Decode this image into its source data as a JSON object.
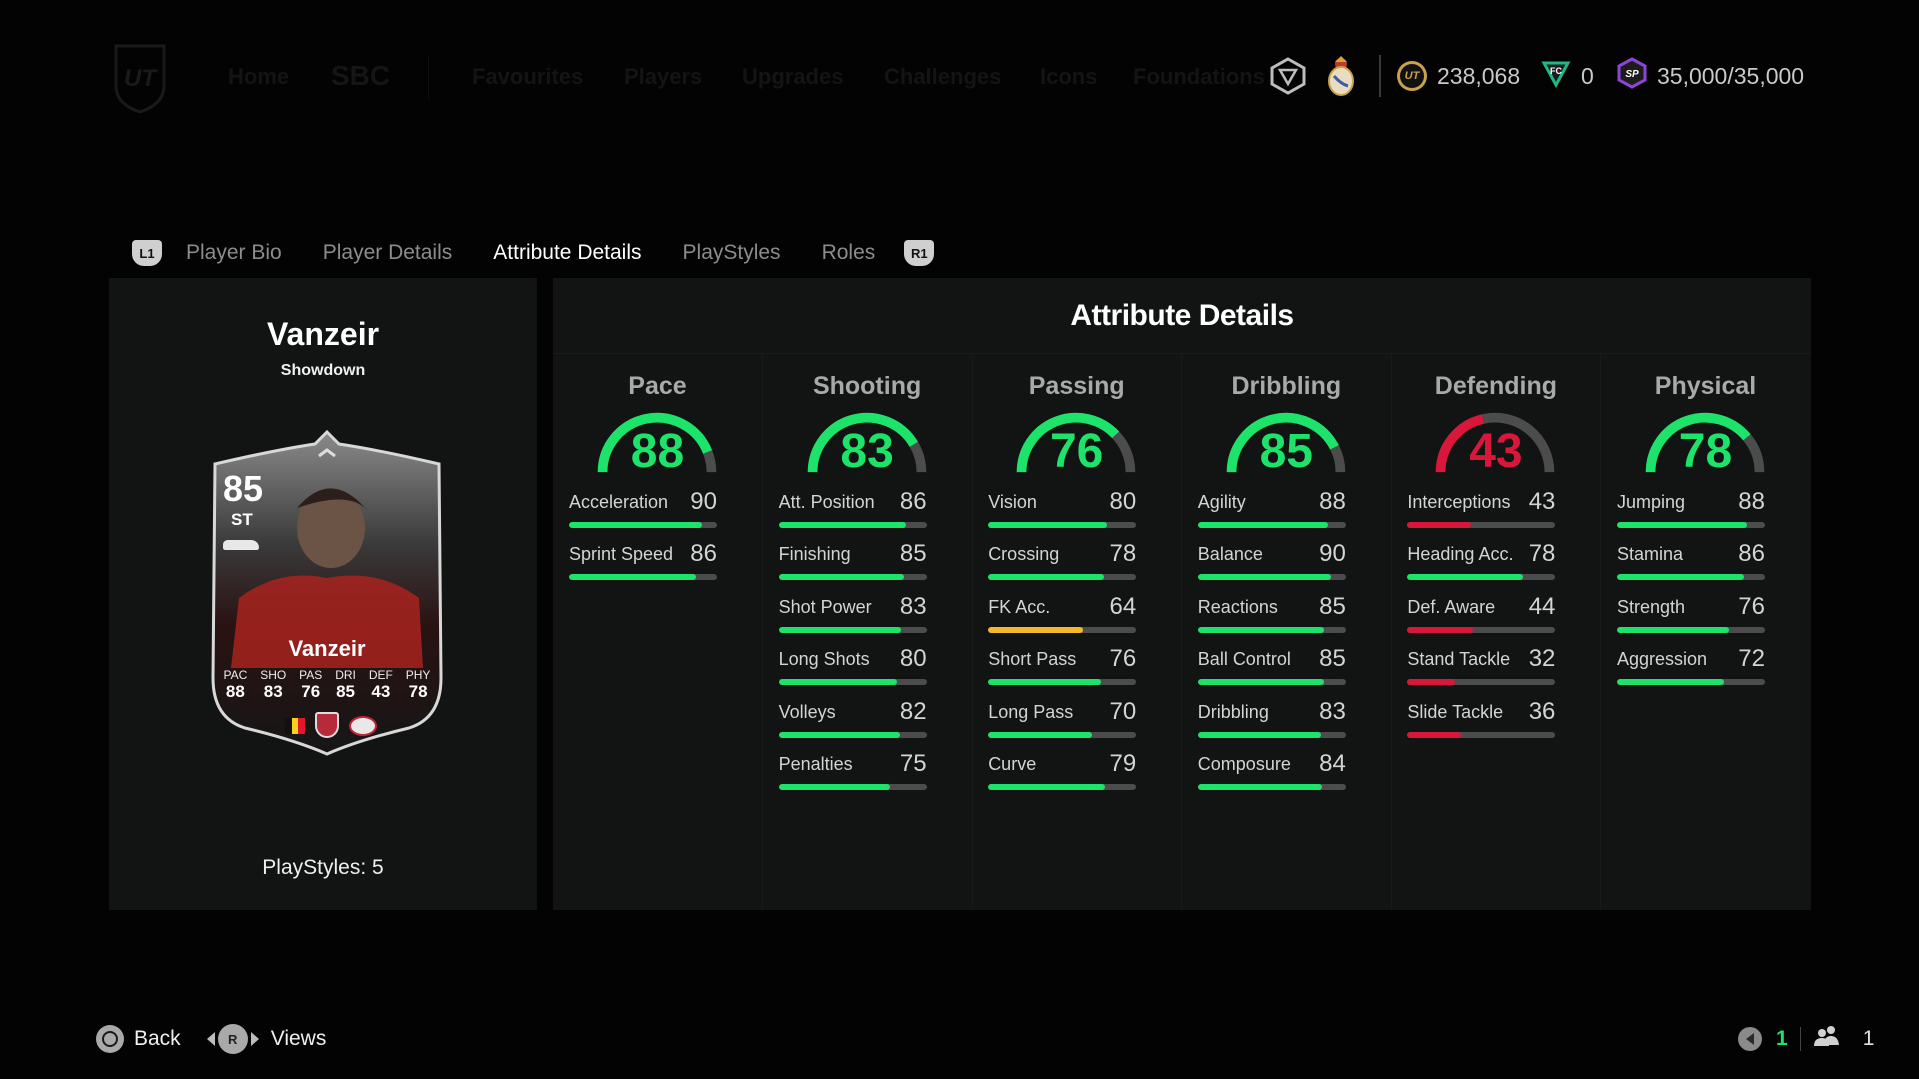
{
  "nav": {
    "items": [
      {
        "label": "Home"
      },
      {
        "label": "SBC"
      },
      {
        "label": "Favourites"
      },
      {
        "label": "Players"
      },
      {
        "label": "Upgrades"
      },
      {
        "label": "Challenges"
      },
      {
        "label": "Icons"
      },
      {
        "label": "Foundations"
      }
    ]
  },
  "currency": {
    "coins": "238,068",
    "fc_points": "0",
    "season_points": "35,000/35,000"
  },
  "tabs": {
    "left_button": "L1",
    "right_button": "R1",
    "items": [
      {
        "label": "Player Bio",
        "active": false
      },
      {
        "label": "Player Details",
        "active": false
      },
      {
        "label": "Attribute Details",
        "active": true
      },
      {
        "label": "PlayStyles",
        "active": false
      },
      {
        "label": "Roles",
        "active": false
      }
    ]
  },
  "player": {
    "name": "Vanzeir",
    "card_type": "Showdown",
    "playstyles": "PlayStyles: 5",
    "card": {
      "rating": "85",
      "position": "ST",
      "name": "Vanzeir",
      "stats": [
        {
          "label": "PAC",
          "value": "88"
        },
        {
          "label": "SHO",
          "value": "83"
        },
        {
          "label": "PAS",
          "value": "76"
        },
        {
          "label": "DRI",
          "value": "85"
        },
        {
          "label": "DEF",
          "value": "43"
        },
        {
          "label": "PHY",
          "value": "78"
        }
      ]
    }
  },
  "attributes": {
    "title": "Attribute Details",
    "colors": {
      "high": "#1ee36b",
      "mid": "#f5b82a",
      "low": "#d9173a",
      "track": "#4b4c4b"
    },
    "categories": [
      {
        "name": "Pace",
        "value": 88,
        "items": [
          {
            "label": "Acceleration",
            "value": 90
          },
          {
            "label": "Sprint Speed",
            "value": 86
          }
        ]
      },
      {
        "name": "Shooting",
        "value": 83,
        "items": [
          {
            "label": "Att. Position",
            "value": 86
          },
          {
            "label": "Finishing",
            "value": 85
          },
          {
            "label": "Shot Power",
            "value": 83
          },
          {
            "label": "Long Shots",
            "value": 80
          },
          {
            "label": "Volleys",
            "value": 82
          },
          {
            "label": "Penalties",
            "value": 75
          }
        ]
      },
      {
        "name": "Passing",
        "value": 76,
        "items": [
          {
            "label": "Vision",
            "value": 80
          },
          {
            "label": "Crossing",
            "value": 78
          },
          {
            "label": "FK Acc.",
            "value": 64
          },
          {
            "label": "Short Pass",
            "value": 76
          },
          {
            "label": "Long Pass",
            "value": 70
          },
          {
            "label": "Curve",
            "value": 79
          }
        ]
      },
      {
        "name": "Dribbling",
        "value": 85,
        "items": [
          {
            "label": "Agility",
            "value": 88
          },
          {
            "label": "Balance",
            "value": 90
          },
          {
            "label": "Reactions",
            "value": 85
          },
          {
            "label": "Ball Control",
            "value": 85
          },
          {
            "label": "Dribbling",
            "value": 83
          },
          {
            "label": "Composure",
            "value": 84
          }
        ]
      },
      {
        "name": "Defending",
        "value": 43,
        "items": [
          {
            "label": "Interceptions",
            "value": 43
          },
          {
            "label": "Heading Acc.",
            "value": 78
          },
          {
            "label": "Def. Aware",
            "value": 44
          },
          {
            "label": "Stand Tackle",
            "value": 32
          },
          {
            "label": "Slide Tackle",
            "value": 36
          }
        ]
      },
      {
        "name": "Physical",
        "value": 78,
        "items": [
          {
            "label": "Jumping",
            "value": 88
          },
          {
            "label": "Stamina",
            "value": 86
          },
          {
            "label": "Strength",
            "value": 76
          },
          {
            "label": "Aggression",
            "value": 72
          }
        ]
      }
    ]
  },
  "footer": {
    "back_label": "Back",
    "views_label": "Views",
    "r_button": "R",
    "voice_count": "1",
    "party_count": "1"
  }
}
